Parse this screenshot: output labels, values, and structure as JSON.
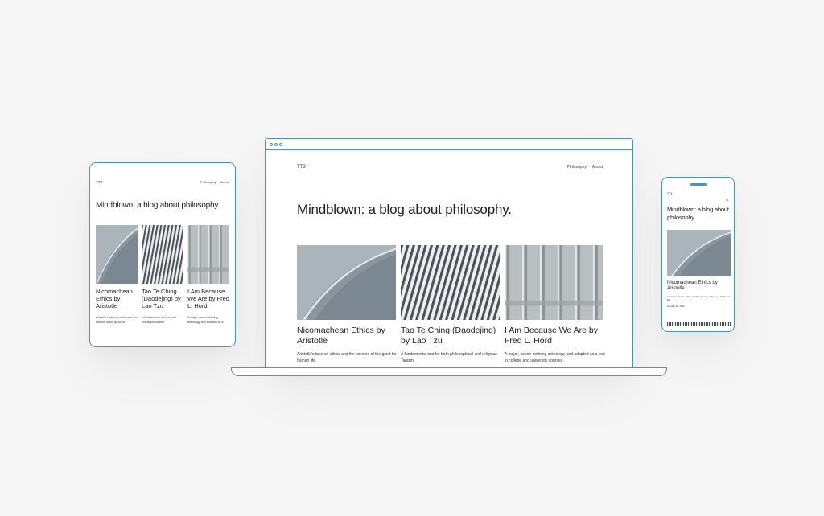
{
  "site": {
    "title": "TT3",
    "nav": [
      "Philosophy",
      "About"
    ],
    "tagline": "Mindblown: a blog about philosophy."
  },
  "posts": [
    {
      "title": "Nicomachean Ethics by Aristotle",
      "excerpt": "Aristotle's take on ethics and the science of the good for human life.",
      "excerpt_tablet": "Aristotle's take on ethics and the science of the good for",
      "excerpt_phone": "Aristotle's take on ethics and the science of the good for human life.",
      "date": "October 18, 2022"
    },
    {
      "title": "Tao Te Ching (Daodejing) by Lao Tzu",
      "excerpt": "A fundamental text for both philosophical and religious Taoism.",
      "excerpt_tablet": "A fundamental text for both philosophical and"
    },
    {
      "title": "I Am Because We Are by Fred L. Hord",
      "excerpt": "A major, canon-defining anthology and adopted as a text in college and university courses.",
      "excerpt_tablet": "A major, canon-defining anthology and adopted as a"
    }
  ],
  "colors": {
    "frame": "#4c93b4",
    "background": "#f6f6f7",
    "text": "#1e1e1e"
  },
  "icons": {
    "phone_menu": "search-icon"
  }
}
